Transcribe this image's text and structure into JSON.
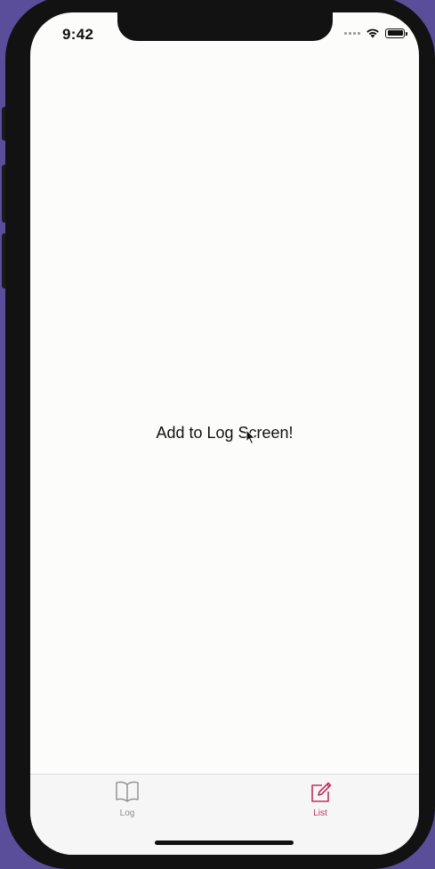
{
  "status_bar": {
    "time": "9:42",
    "icons": [
      "signal-dots",
      "wifi-icon",
      "battery-icon"
    ]
  },
  "main": {
    "message": "Add to Log Screen!"
  },
  "tab_bar": {
    "tabs": [
      {
        "label": "Log",
        "icon": "book-icon",
        "selected": false
      },
      {
        "label": "List",
        "icon": "compose-icon",
        "selected": true
      }
    ],
    "active_color": "#c0305f",
    "inactive_color": "#8e8e8e"
  },
  "colors": {
    "background": "#5a4d9a",
    "screen": "#fcfcfb"
  }
}
